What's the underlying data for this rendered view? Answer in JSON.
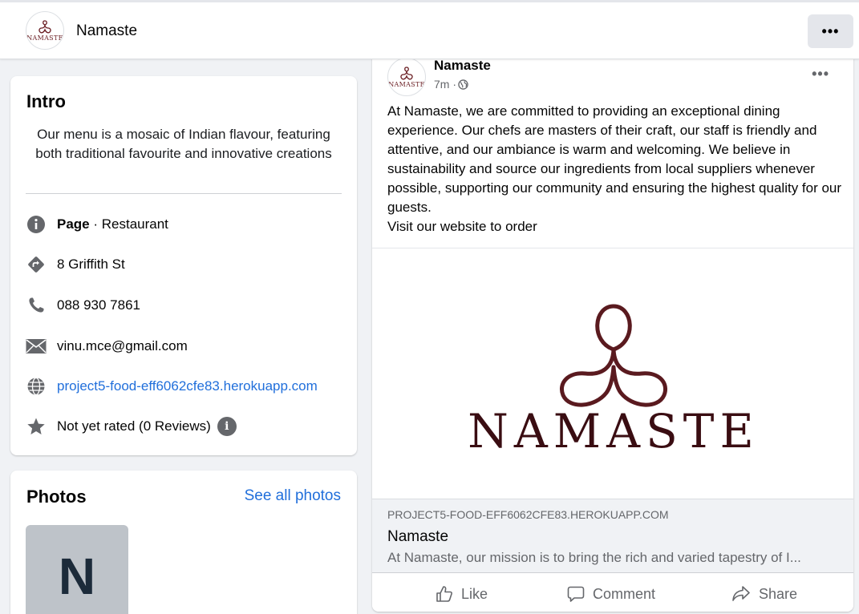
{
  "header": {
    "page_name": "Namaste",
    "logo_text": "NAMASTE",
    "more_label": "•••"
  },
  "intro": {
    "title": "Intro",
    "bio": "Our menu is a mosaic of Indian flavour, featuring both traditional favourite and innovative creations",
    "category_label": "Page",
    "category_value": " · Restaurant",
    "address": "8 Griffith St",
    "phone": "088 930 7861",
    "email": "vinu.mce@gmail.com",
    "website": "project5-food-eff6062cfe83.herokuapp.com",
    "rating": "Not yet rated (0 Reviews)",
    "rating_info_icon": "i"
  },
  "photos": {
    "title": "Photos",
    "see_all": "See all photos",
    "thumb_letter": "N"
  },
  "post": {
    "author": "Namaste",
    "time": "7m · ",
    "more_label": "•••",
    "text_paragraph": "At Namaste, we are committed to providing an exceptional dining experience. Our chefs are masters of their craft, our staff is friendly and attentive, and our ambiance is warm and welcoming. We believe in sustainability and source our ingredients from local suppliers whenever possible, supporting our community and ensuring the highest quality for our guests.",
    "text_cta": "Visit our website to order",
    "image_logo_text": "NAMASTE",
    "link_preview": {
      "domain": "PROJECT5-FOOD-EFF6062CFE83.HEROKUAPP.COM",
      "title": "Namaste",
      "description": "At Namaste, our mission is to bring the rich and varied tapestry of I..."
    },
    "actions": {
      "like": "Like",
      "comment": "Comment",
      "share": "Share"
    }
  },
  "colors": {
    "brand_maroon": "#6b1f24",
    "link_blue": "#216fdb",
    "icon_gray": "#65676b"
  }
}
